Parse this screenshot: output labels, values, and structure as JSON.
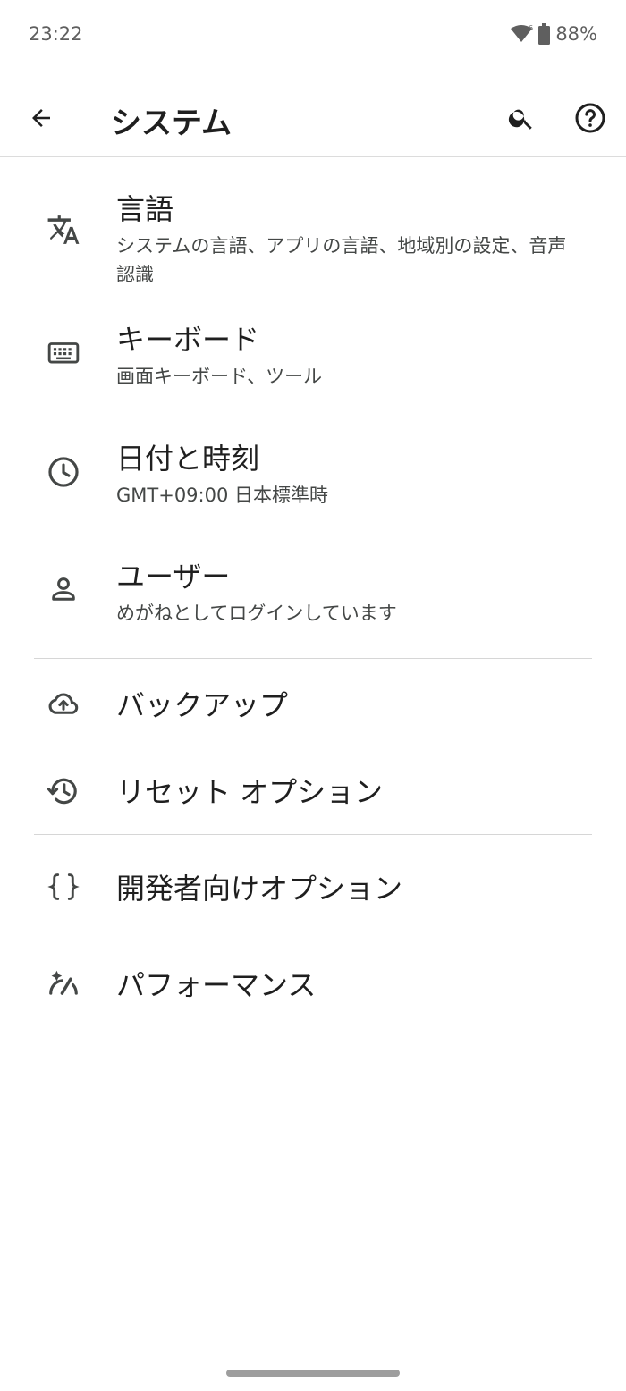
{
  "status_bar": {
    "time": "23:22",
    "wifi_badge": "6",
    "battery_percent": "88%",
    "battery_level": 0.88
  },
  "app_bar": {
    "title": "システム",
    "back_icon": "arrow-back-icon",
    "search_icon": "search-icon",
    "help_icon": "help-icon"
  },
  "items": [
    {
      "label": "言語",
      "summary": "システムの言語、アプリの言語、地域別の設定、音声認識",
      "icon": "translate-icon"
    },
    {
      "label": "キーボード",
      "summary": "画面キーボード、ツール",
      "icon": "keyboard-icon"
    },
    {
      "label": "日付と時刻",
      "summary": "GMT+09:00 日本標準時",
      "icon": "clock-icon"
    },
    {
      "label": "ユーザー",
      "summary": "めがねとしてログインしています",
      "icon": "person-icon"
    },
    {
      "label": "バックアップ",
      "icon": "cloud-upload-icon"
    },
    {
      "label": "リセット オプション",
      "icon": "history-reset-icon"
    },
    {
      "label": "開発者向けオプション",
      "icon": "code-braces-icon"
    },
    {
      "label": "パフォーマンス",
      "icon": "performance-gauge-icon"
    }
  ]
}
